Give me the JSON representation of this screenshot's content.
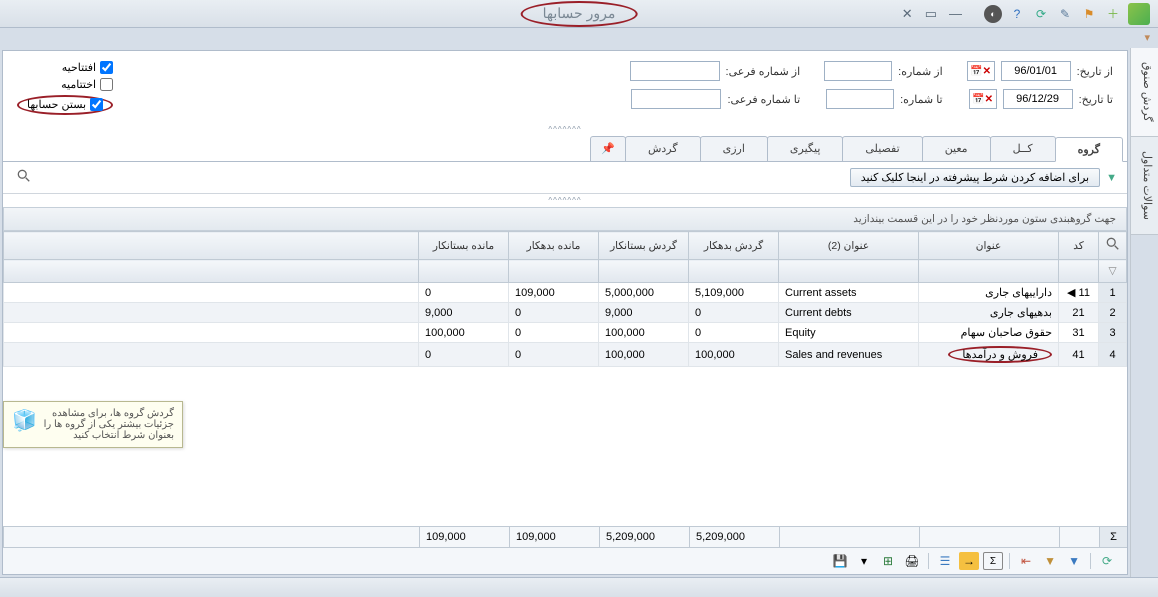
{
  "window": {
    "title": "مرور حسابها"
  },
  "filters": {
    "fromDateLabel": "از تاریخ:",
    "toDateLabel": "تا تاریخ:",
    "fromDate": "96/01/01",
    "toDate": "96/12/29",
    "fromNumLabel": "از شماره:",
    "toNumLabel": "تا شماره:",
    "fromSubLabel": "از شماره فرعی:",
    "toSubLabel": "تا شماره فرعی:"
  },
  "checks": {
    "open": "افتتاحیه",
    "close": "اختتامیه",
    "closeAcc": "بستن حسابها"
  },
  "tabs": {
    "group": "گروه",
    "total": "کــل",
    "moein": "معین",
    "detail": "تفصیلی",
    "follow": "پیگیری",
    "currency": "ارزی",
    "cycle": "گردش"
  },
  "advBtn": "برای اضافه کردن شرط پیشرفته در اینجا کلیک کنید",
  "groupHint": "جهت گروهبندی ستون موردنظر خود را در این قسمت بیندازید",
  "columns": {
    "code": "کد",
    "title": "عنوان",
    "title2": "عنوان (2)",
    "debitCycle": "گردش بدهکار",
    "creditCycle": "گردش بستانکار",
    "debitBal": "مانده بدهکار",
    "creditBal": "مانده بستانکار"
  },
  "rows": [
    {
      "n": "1",
      "code": "11",
      "title": "داراییهای جاری",
      "title2": "Current assets",
      "dc": "5,109,000",
      "cc": "5,000,000",
      "db": "109,000",
      "cb": "0"
    },
    {
      "n": "2",
      "code": "21",
      "title": "بدهیهای جاری",
      "title2": "Current debts",
      "dc": "0",
      "cc": "9,000",
      "db": "0",
      "cb": "9,000"
    },
    {
      "n": "3",
      "code": "31",
      "title": "حقوق صاحبان سهام",
      "title2": "Equity",
      "dc": "0",
      "cc": "100,000",
      "db": "0",
      "cb": "100,000"
    },
    {
      "n": "4",
      "code": "41",
      "title": "فروش و درآمدها",
      "title2": "Sales and revenues",
      "dc": "100,000",
      "cc": "100,000",
      "db": "0",
      "cb": "0"
    }
  ],
  "totals": {
    "dc": "5,209,000",
    "cc": "5,209,000",
    "db": "109,000",
    "cb": "109,000"
  },
  "tooltip": "گردش گروه ها، برای مشاهده جزئیات بیشتر یکی از گروه ها را بعنوان شرط انتخاب کنید",
  "sideTabs": {
    "circ": "گردش صنوق",
    "meta": "سوالات متداول"
  }
}
